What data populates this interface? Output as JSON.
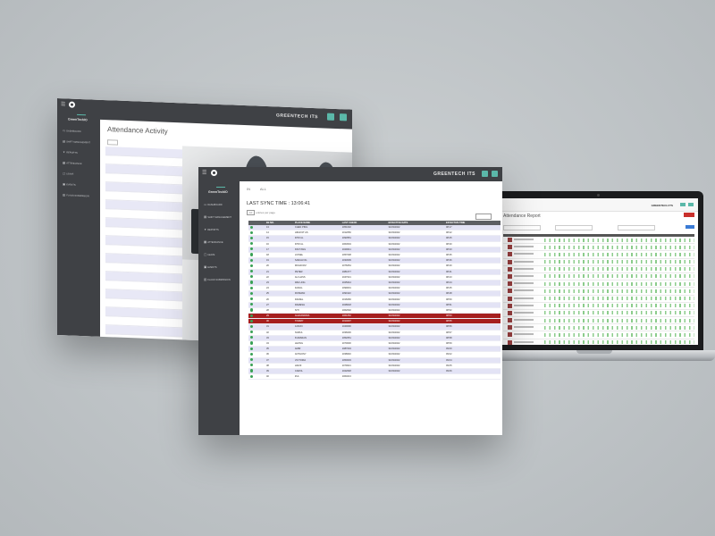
{
  "brand": "GREENTECH ITS",
  "sidebar_brand": "GreenTechIO",
  "back_window": {
    "page_title": "Attendance Activity",
    "nav_items": [
      "DASHBOARD",
      "SHIFT MANAGEMENT",
      "REPORTS",
      "ATTENDANCE",
      "LEAVE",
      "EVENTS",
      "FLAGS SUBMISSION"
    ]
  },
  "front_window": {
    "tabs": [
      "IN",
      "ALL"
    ],
    "sync_label": "LAST SYNC TIME :",
    "sync_time": "13:06:41",
    "page_size": "10",
    "page_size_suffix": "entries per page",
    "nav_items": [
      "DASHBOARD",
      "SHIFT MANAGEMENT",
      "REPORTS",
      "ATTENDANCE",
      "LEAVE",
      "EVENTS",
      "FLAGS SUBMISSION"
    ],
    "table": {
      "headers": [
        "",
        "EE NO.",
        "PLACE NAME",
        "LAST CHECK",
        "EFFECTIVE DATE",
        "EFFECTIVE TIME"
      ],
      "rows": [
        {
          "no": "13",
          "name": "CHEN PING",
          "code": "1051002",
          "date": "31/03/2022",
          "time": "08:17",
          "hl": false
        },
        {
          "no": "14",
          "name": "HIDAYAT AS",
          "code": "1012050",
          "date": "31/03/2022",
          "time": "08:22",
          "hl": false
        },
        {
          "no": "15",
          "name": "RITZ AL",
          "code": "1093551",
          "date": "31/03/2022",
          "time": "08:25",
          "hl": false
        },
        {
          "no": "16",
          "name": "RITZ AL",
          "code": "1063004",
          "date": "31/03/2022",
          "time": "08:30",
          "hl": false
        },
        {
          "no": "17",
          "name": "KIM TANG",
          "code": "1029041",
          "date": "31/03/2022",
          "time": "08:33",
          "hl": false
        },
        {
          "no": "18",
          "name": "LIONEL",
          "code": "1057038",
          "date": "31/03/2022",
          "time": "08:35",
          "hl": false
        },
        {
          "no": "19",
          "name": "SARAH NG",
          "code": "1033009",
          "date": "31/03/2022",
          "time": "08:36",
          "hl": false
        },
        {
          "no": "20",
          "name": "MOHD RIZ",
          "code": "1076054",
          "date": "31/03/2022",
          "time": "08:40",
          "hl": false
        },
        {
          "no": "21",
          "name": "PETER",
          "code": "1081077",
          "date": "31/03/2022",
          "time": "08:41",
          "hl": false
        },
        {
          "no": "22",
          "name": "ALI HASS",
          "code": "1047021",
          "date": "31/03/2022",
          "time": "08:43",
          "hl": false
        },
        {
          "no": "23",
          "name": "WEI LING",
          "code": "1025044",
          "date": "31/03/2022",
          "time": "08:44",
          "hl": false
        },
        {
          "no": "24",
          "name": "FAIZAL",
          "code": "1099001",
          "date": "31/03/2022",
          "time": "08:45",
          "hl": false
        },
        {
          "no": "25",
          "name": "ROSMAN",
          "code": "1090113",
          "date": "31/03/2022",
          "time": "08:48",
          "hl": false
        },
        {
          "no": "26",
          "name": "DANIEL",
          "code": "1016066",
          "date": "31/03/2022",
          "time": "08:50",
          "hl": false
        },
        {
          "no": "27",
          "name": "RAMESH",
          "code": "1028018",
          "date": "31/03/2022",
          "time": "08:51",
          "hl": false
        },
        {
          "no": "28",
          "name": "SITI",
          "code": "1062002",
          "date": "31/03/2022",
          "time": "08:52",
          "hl": false
        },
        {
          "no": "29",
          "name": "ALEXANDRIA",
          "code": "1061052",
          "date": "31/03/2022",
          "time": "08:53",
          "hl": true
        },
        {
          "no": "30",
          "name": "TOMMY",
          "code": "1014007",
          "date": "31/03/2022",
          "time": "08:55",
          "hl": true
        },
        {
          "no": "31",
          "name": "JASON",
          "code": "1049090",
          "date": "31/03/2022",
          "time": "08:56",
          "hl": false
        },
        {
          "no": "32",
          "name": "NURUL",
          "code": "1036036",
          "date": "31/03/2022",
          "time": "08:57",
          "hl": false
        },
        {
          "no": "33",
          "name": "KUMARAN",
          "code": "1052051",
          "date": "31/03/2022",
          "time": "08:58",
          "hl": false
        },
        {
          "no": "34",
          "name": "LEONG",
          "code": "1070030",
          "date": "31/03/2022",
          "time": "08:59",
          "hl": false
        },
        {
          "no": "35",
          "name": "AMIR",
          "code": "1087004",
          "date": "31/03/2022",
          "time": "09:00",
          "hl": false
        },
        {
          "no": "36",
          "name": "ANTHONY",
          "code": "1038040",
          "date": "31/03/2022",
          "time": "09:02",
          "hl": false
        },
        {
          "no": "37",
          "name": "VICTORIA",
          "code": "1050003",
          "date": "31/03/2022",
          "time": "09:04",
          "hl": false
        },
        {
          "no": "38",
          "name": "HAFIZ",
          "code": "1079021",
          "date": "31/03/2022",
          "time": "09:05",
          "hl": false
        },
        {
          "no": "39",
          "name": "CAROL",
          "code": "1022048",
          "date": "31/03/2022",
          "time": "09:06",
          "hl": false
        },
        {
          "no": "40",
          "name": "ZUL",
          "code": "1064013",
          "date": "",
          "time": "",
          "hl": false
        }
      ]
    }
  },
  "laptop": {
    "page_title": "Attendance Report",
    "brand": "GREENTECH ITS",
    "row_count": 17
  },
  "colors": {
    "sidebar": "#3f4145",
    "accent": "#5bb8a9",
    "highlight_row": "#a61f1f",
    "stripe": "#e3e3f5",
    "check": "#39a155"
  }
}
